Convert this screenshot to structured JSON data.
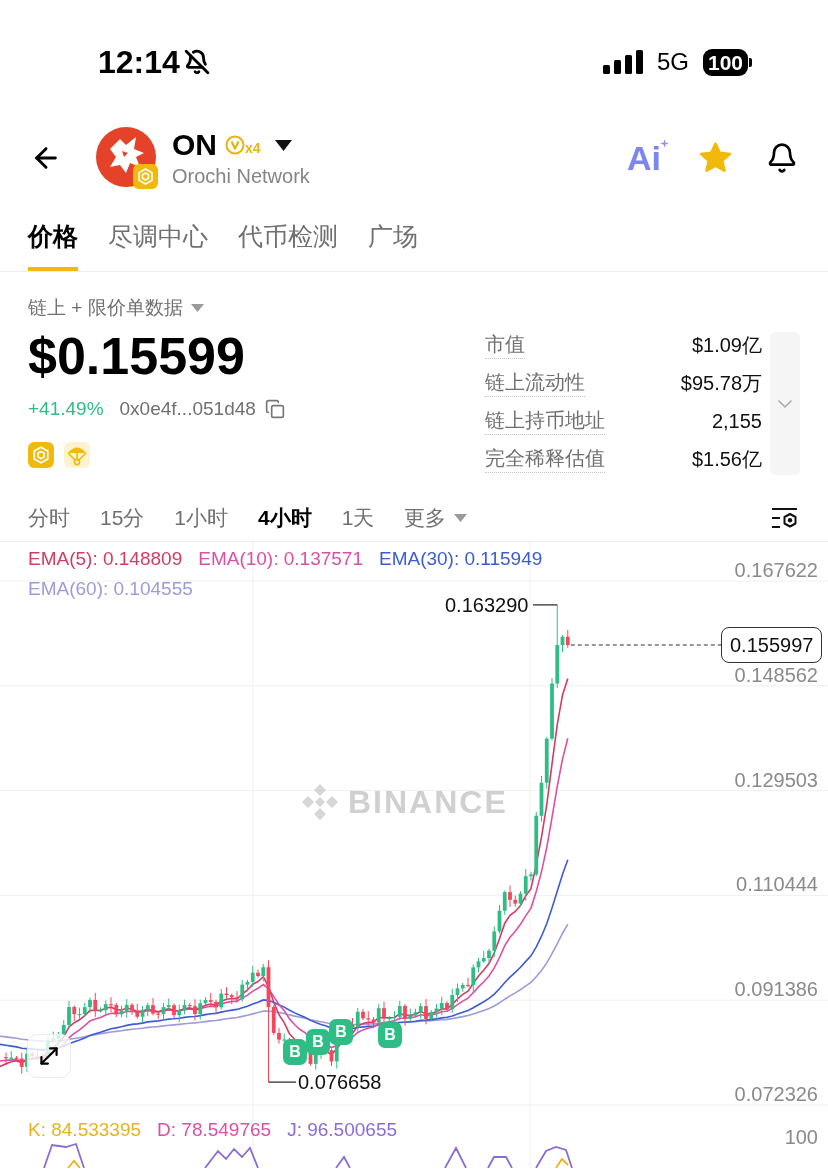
{
  "status_bar": {
    "time": "12:14",
    "network": "5G",
    "battery": "100"
  },
  "header": {
    "symbol": "ON",
    "badge": "x4",
    "name": "Orochi Network",
    "ai_button": "Ai",
    "favorite": true
  },
  "tabs": [
    {
      "label": "价格",
      "selected": true
    },
    {
      "label": "尽调中心",
      "selected": false
    },
    {
      "label": "代币检测",
      "selected": false
    },
    {
      "label": "广场",
      "selected": false
    }
  ],
  "data_source": "链上 + 限价单数据",
  "price": "$0.15599",
  "change": "+41.49%",
  "address": "0x0e4f...051d48",
  "stats": [
    {
      "label": "市值",
      "value": "$1.09亿"
    },
    {
      "label": "链上流动性",
      "value": "$95.78万"
    },
    {
      "label": "链上持币地址",
      "value": "2,155"
    },
    {
      "label": "完全稀释估值",
      "value": "$1.56亿"
    }
  ],
  "intervals": [
    {
      "label": "分时",
      "kind": "option",
      "selected": false
    },
    {
      "label": "15分",
      "kind": "option",
      "selected": false
    },
    {
      "label": "1小时",
      "kind": "option",
      "selected": false
    },
    {
      "label": "4小时",
      "kind": "option",
      "selected": true
    },
    {
      "label": "1天",
      "kind": "option",
      "selected": false
    },
    {
      "label": "更多",
      "kind": "menu",
      "selected": false
    }
  ],
  "chart": {
    "indicators": [
      {
        "label": "EMA(5): 0.148809",
        "color": "#d23c64"
      },
      {
        "label": "EMA(10): 0.137571",
        "color": "#dc4fa6"
      },
      {
        "label": "EMA(30): 0.115949",
        "color": "#3c5cd2"
      },
      {
        "label": "EMA(60): 0.104555",
        "color": "#9c9cdc"
      }
    ],
    "y_labels": [
      "0.167622",
      "0.148562",
      "0.129503",
      "0.110444",
      "0.091386",
      "0.072326"
    ],
    "high_label": "0.163290",
    "low_label": "0.076658",
    "last_price": "0.155997",
    "watermark": "BINANCE",
    "markers": [
      "B",
      "B",
      "B",
      "B"
    ]
  },
  "kdj": {
    "indicators": [
      {
        "label": "K: 84.533395",
        "color": "#e7b41e"
      },
      {
        "label": "D: 78.549765",
        "color": "#dc4fa6"
      },
      {
        "label": "J: 96.500655",
        "color": "#8c6cd4"
      }
    ],
    "axis_label": "100"
  }
}
